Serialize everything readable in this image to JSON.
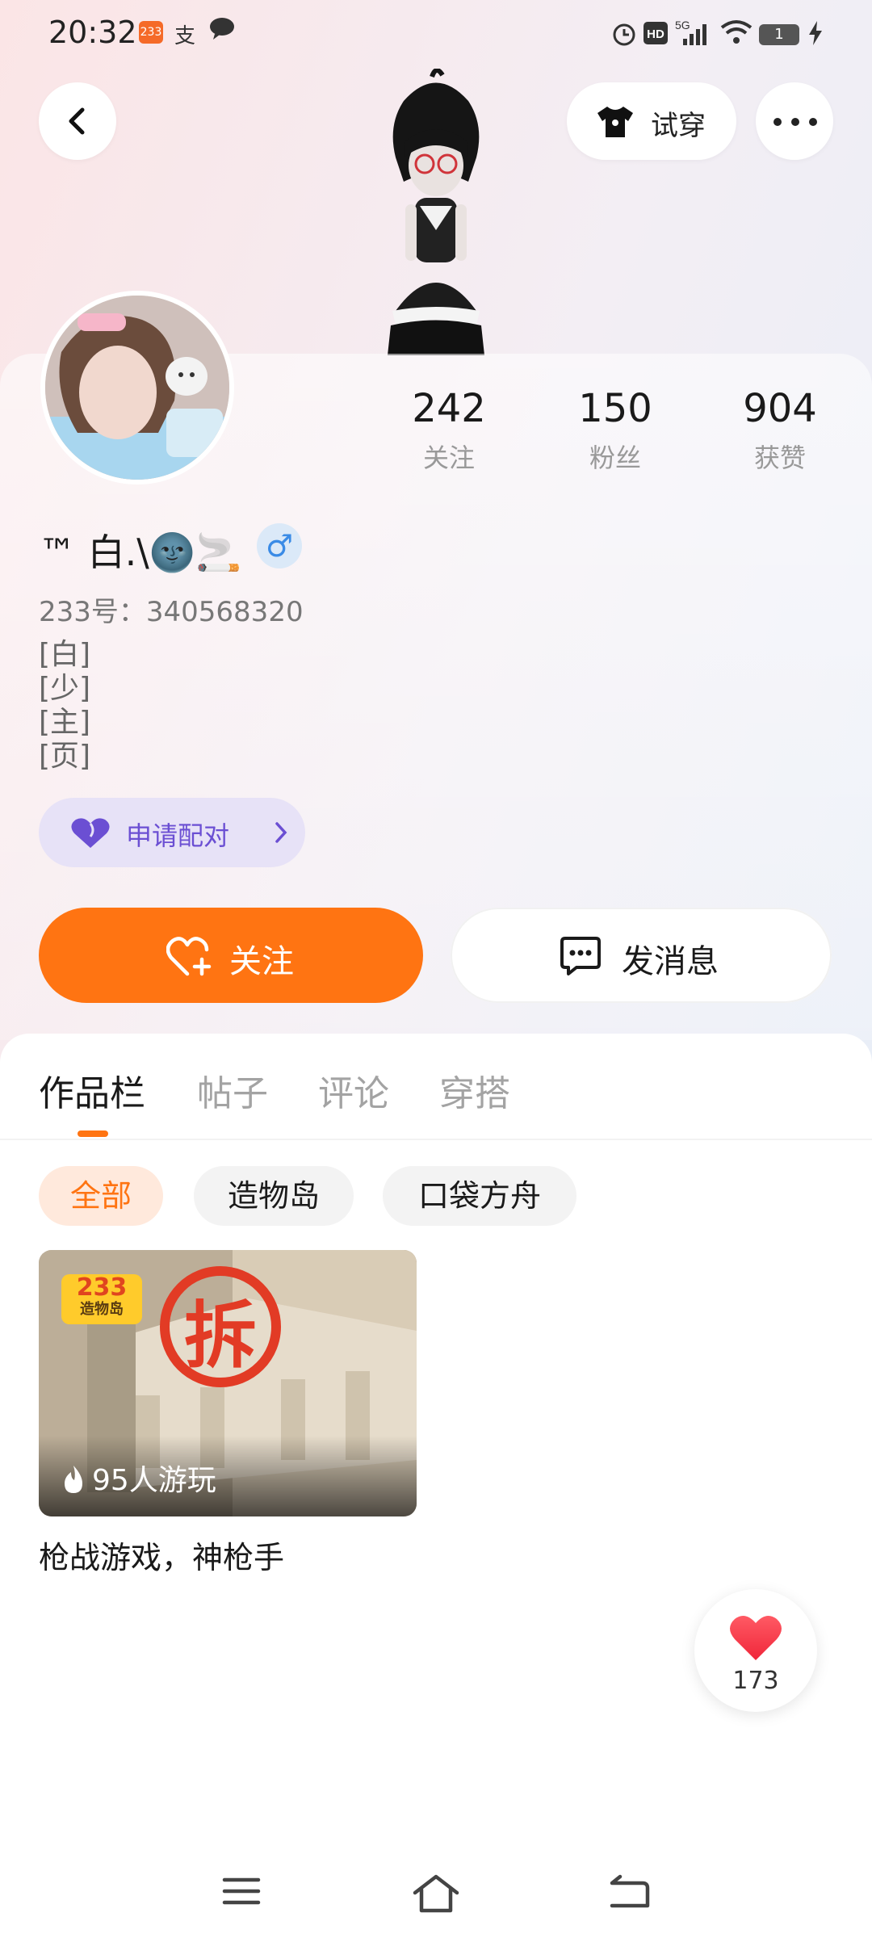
{
  "status_bar": {
    "time": "20:32",
    "badge": "233",
    "battery": "1",
    "network": "5G"
  },
  "header": {
    "try_on_label": "试穿"
  },
  "stats": [
    {
      "num": "242",
      "label": "关注"
    },
    {
      "num": "150",
      "label": "粉丝"
    },
    {
      "num": "904",
      "label": "获赞"
    }
  ],
  "profile": {
    "name": "™ 白.\\🌚🚬",
    "gender_symbol": "♂",
    "uid": "233号：340568320",
    "bio": [
      "[白]",
      "[少]",
      "[主]",
      "[页]"
    ]
  },
  "pair_button": {
    "label": "申请配对"
  },
  "actions": {
    "follow_label": "关注",
    "message_label": "发消息"
  },
  "tabs": [
    "作品栏",
    "帖子",
    "评论",
    "穿搭"
  ],
  "filters": [
    "全部",
    "造物岛",
    "口袋方舟"
  ],
  "works": [
    {
      "title": "枪战游戏，神枪手",
      "plays": "95人游玩",
      "logo_top": "233",
      "logo_bottom": "造物岛",
      "sign": "拆"
    }
  ],
  "likes": {
    "count": "173"
  },
  "colors": {
    "accent": "#ff7412",
    "pair_purple": "#6b4fd3"
  }
}
